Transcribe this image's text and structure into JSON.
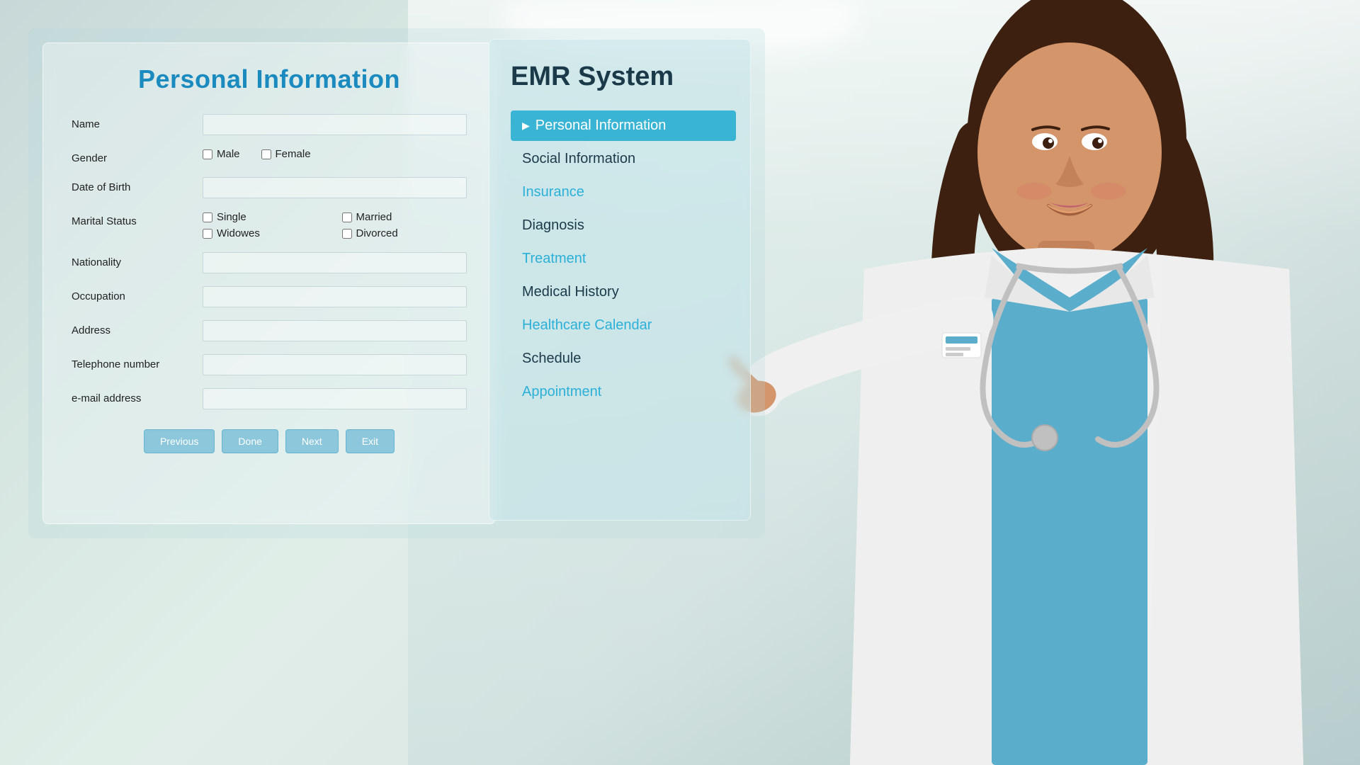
{
  "background": {
    "color_start": "#c8d8d8",
    "color_end": "#b8caca"
  },
  "form": {
    "title": "Personal Information",
    "fields": {
      "name": {
        "label": "Name",
        "placeholder": ""
      },
      "gender": {
        "label": "Gender",
        "options": [
          "Male",
          "Female"
        ]
      },
      "dob": {
        "label": "Date of Birth",
        "placeholder": ""
      },
      "marital_status": {
        "label": "Marital Status",
        "options": [
          "Single",
          "Married",
          "Widowes",
          "Divorced"
        ]
      },
      "nationality": {
        "label": "Nationality",
        "placeholder": ""
      },
      "occupation": {
        "label": "Occupation",
        "placeholder": ""
      },
      "address": {
        "label": "Address",
        "placeholder": ""
      },
      "telephone": {
        "label": "Telephone number",
        "placeholder": ""
      },
      "email": {
        "label": "e-mail address",
        "placeholder": ""
      }
    },
    "buttons": {
      "previous": "Previous",
      "done": "Done",
      "next": "Next",
      "exit": "Exit"
    }
  },
  "emr": {
    "title": "EMR System",
    "menu_items": [
      {
        "label": "Personal Information",
        "state": "active"
      },
      {
        "label": "Social Information",
        "state": "normal"
      },
      {
        "label": "Insurance",
        "state": "highlighted"
      },
      {
        "label": "Diagnosis",
        "state": "normal"
      },
      {
        "label": "Treatment",
        "state": "highlighted"
      },
      {
        "label": "Medical History",
        "state": "normal"
      },
      {
        "label": "Healthcare Calendar",
        "state": "highlighted"
      },
      {
        "label": "Schedule",
        "state": "normal"
      },
      {
        "label": "Appointment",
        "state": "highlighted"
      }
    ]
  }
}
